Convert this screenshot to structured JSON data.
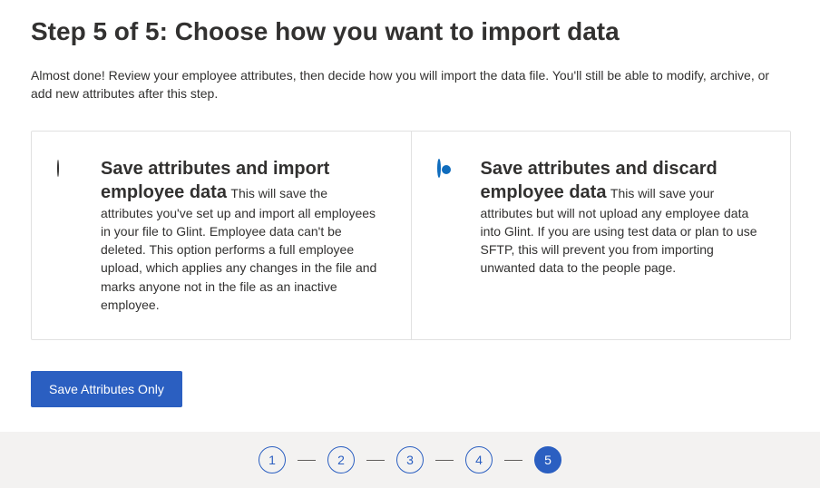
{
  "heading": "Step 5 of 5: Choose how you want to import data",
  "intro": "Almost done! Review your employee attributes, then decide how you will import the data file. You'll still be able to modify, archive, or add new attributes after this step.",
  "options": [
    {
      "title": "Save attributes and import employee data",
      "desc": "This will save the attributes you've set up and import all employees in your file to Glint. Employee data can't be deleted. This option performs a full employee upload, which applies any changes in the file and marks anyone not in the file as an inactive employee.",
      "selected": false
    },
    {
      "title": "Save attributes and discard employee data",
      "desc": "This will save your attributes but will not upload any employee data into Glint. If you are using test data or plan to use SFTP, this will prevent you from importing unwanted data to the people page.",
      "selected": true
    }
  ],
  "primary_button": "Save Attributes Only",
  "stepper": {
    "steps": [
      "1",
      "2",
      "3",
      "4",
      "5"
    ],
    "active_index": 4
  },
  "colors": {
    "primary": "#2b5fc1",
    "radio_accent": "#0f6cbd"
  }
}
